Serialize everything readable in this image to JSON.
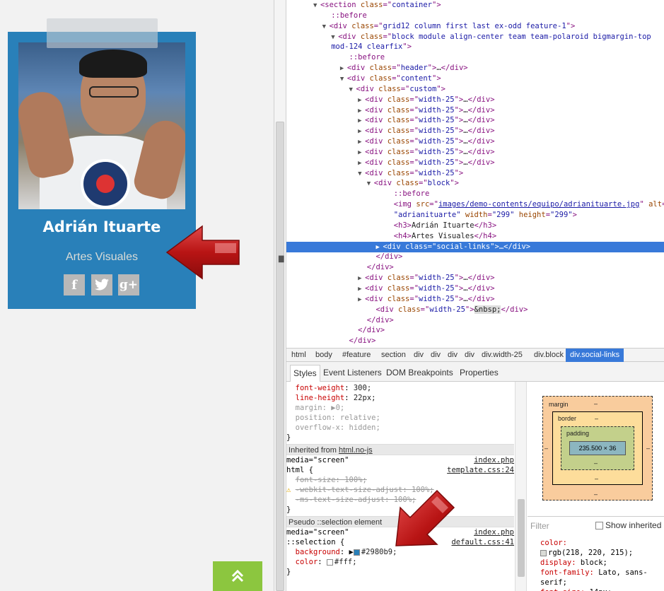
{
  "page": {
    "member_name": "Adrián Ituarte",
    "member_role": "Artes Visuales",
    "social": [
      "f",
      "t",
      "g+"
    ],
    "scroll_top_icon": "double-chevron-up-icon",
    "accent": "#2980b9",
    "scroll_top_color": "#8cc63f"
  },
  "tree": [
    {
      "t": "▼",
      "i": 3,
      "parts": [
        [
          "tag",
          "<section "
        ],
        [
          "an",
          "class"
        ],
        [
          "tag",
          "=\""
        ],
        [
          "av",
          "container"
        ],
        [
          "tag",
          "\">"
        ]
      ]
    },
    {
      "t": "",
      "i": 4,
      "parts": [
        [
          "pseudo",
          "::before"
        ]
      ]
    },
    {
      "t": "▼",
      "i": 4,
      "parts": [
        [
          "tag",
          "<div "
        ],
        [
          "an",
          "class"
        ],
        [
          "tag",
          "=\""
        ],
        [
          "av",
          "grid12 column first last ex-odd feature-1"
        ],
        [
          "tag",
          "\">"
        ]
      ]
    },
    {
      "t": "▼",
      "i": 5,
      "parts": [
        [
          "tag",
          "<div "
        ],
        [
          "an",
          "class"
        ],
        [
          "tag",
          "=\""
        ],
        [
          "av",
          "block module align-center team team-polaroid bigmargin-top"
        ]
      ]
    },
    {
      "t": "",
      "i": 4,
      "parts": [
        [
          "av",
          "mod-124 clearfix"
        ],
        [
          "tag",
          "\">"
        ]
      ]
    },
    {
      "t": "",
      "i": 6,
      "parts": [
        [
          "pseudo",
          "::before"
        ]
      ]
    },
    {
      "t": "▶",
      "i": 6,
      "parts": [
        [
          "tag",
          "<div "
        ],
        [
          "an",
          "class"
        ],
        [
          "tag",
          "=\""
        ],
        [
          "av",
          "header"
        ],
        [
          "tag",
          "\">"
        ],
        [
          "plain",
          "…"
        ],
        [
          "tag",
          "</div>"
        ]
      ]
    },
    {
      "t": "▼",
      "i": 6,
      "parts": [
        [
          "tag",
          "<div "
        ],
        [
          "an",
          "class"
        ],
        [
          "tag",
          "=\""
        ],
        [
          "av",
          "content"
        ],
        [
          "tag",
          "\">"
        ]
      ]
    },
    {
      "t": "▼",
      "i": 7,
      "parts": [
        [
          "tag",
          "<div "
        ],
        [
          "an",
          "class"
        ],
        [
          "tag",
          "=\""
        ],
        [
          "av",
          "custom"
        ],
        [
          "tag",
          "\">"
        ]
      ]
    },
    {
      "t": "▶",
      "i": 8,
      "parts": [
        [
          "tag",
          "<div "
        ],
        [
          "an",
          "class"
        ],
        [
          "tag",
          "=\""
        ],
        [
          "av",
          "width-25"
        ],
        [
          "tag",
          "\">"
        ],
        [
          "plain",
          "…"
        ],
        [
          "tag",
          "</div>"
        ]
      ]
    },
    {
      "t": "▶",
      "i": 8,
      "parts": [
        [
          "tag",
          "<div "
        ],
        [
          "an",
          "class"
        ],
        [
          "tag",
          "=\""
        ],
        [
          "av",
          "width-25"
        ],
        [
          "tag",
          "\">"
        ],
        [
          "plain",
          "…"
        ],
        [
          "tag",
          "</div>"
        ]
      ]
    },
    {
      "t": "▶",
      "i": 8,
      "parts": [
        [
          "tag",
          "<div "
        ],
        [
          "an",
          "class"
        ],
        [
          "tag",
          "=\""
        ],
        [
          "av",
          "width-25"
        ],
        [
          "tag",
          "\">"
        ],
        [
          "plain",
          "…"
        ],
        [
          "tag",
          "</div>"
        ]
      ]
    },
    {
      "t": "▶",
      "i": 8,
      "parts": [
        [
          "tag",
          "<div "
        ],
        [
          "an",
          "class"
        ],
        [
          "tag",
          "=\""
        ],
        [
          "av",
          "width-25"
        ],
        [
          "tag",
          "\">"
        ],
        [
          "plain",
          "…"
        ],
        [
          "tag",
          "</div>"
        ]
      ]
    },
    {
      "t": "▶",
      "i": 8,
      "parts": [
        [
          "tag",
          "<div "
        ],
        [
          "an",
          "class"
        ],
        [
          "tag",
          "=\""
        ],
        [
          "av",
          "width-25"
        ],
        [
          "tag",
          "\">"
        ],
        [
          "plain",
          "…"
        ],
        [
          "tag",
          "</div>"
        ]
      ]
    },
    {
      "t": "▶",
      "i": 8,
      "parts": [
        [
          "tag",
          "<div "
        ],
        [
          "an",
          "class"
        ],
        [
          "tag",
          "=\""
        ],
        [
          "av",
          "width-25"
        ],
        [
          "tag",
          "\">"
        ],
        [
          "plain",
          "…"
        ],
        [
          "tag",
          "</div>"
        ]
      ]
    },
    {
      "t": "▶",
      "i": 8,
      "parts": [
        [
          "tag",
          "<div "
        ],
        [
          "an",
          "class"
        ],
        [
          "tag",
          "=\""
        ],
        [
          "av",
          "width-25"
        ],
        [
          "tag",
          "\">"
        ],
        [
          "plain",
          "…"
        ],
        [
          "tag",
          "</div>"
        ]
      ]
    },
    {
      "t": "▼",
      "i": 8,
      "parts": [
        [
          "tag",
          "<div "
        ],
        [
          "an",
          "class"
        ],
        [
          "tag",
          "=\""
        ],
        [
          "av",
          "width-25"
        ],
        [
          "tag",
          "\">"
        ]
      ]
    },
    {
      "t": "▼",
      "i": 9,
      "parts": [
        [
          "tag",
          "<div "
        ],
        [
          "an",
          "class"
        ],
        [
          "tag",
          "=\""
        ],
        [
          "av",
          "block"
        ],
        [
          "tag",
          "\">"
        ]
      ]
    },
    {
      "t": "",
      "i": 11,
      "parts": [
        [
          "pseudo",
          "::before"
        ]
      ]
    },
    {
      "t": "",
      "i": 11,
      "parts": [
        [
          "tag",
          "<img "
        ],
        [
          "an",
          "src"
        ],
        [
          "tag",
          "=\""
        ],
        [
          "lnk",
          "images/demo-contents/equipo/adrianituarte.jpg"
        ],
        [
          "tag",
          "\" "
        ],
        [
          "an",
          "alt"
        ],
        [
          "tag",
          "="
        ]
      ]
    },
    {
      "t": "",
      "i": 11,
      "parts": [
        [
          "av",
          "\"adrianituarte\" "
        ],
        [
          "an",
          "width"
        ],
        [
          "tag",
          "="
        ],
        [
          "av",
          "\"299\" "
        ],
        [
          "an",
          "height"
        ],
        [
          "tag",
          "="
        ],
        [
          "av",
          "\"299\""
        ],
        [
          "tag",
          ">"
        ]
      ]
    },
    {
      "t": "",
      "i": 11,
      "parts": [
        [
          "tag",
          "<h3>"
        ],
        [
          "plain",
          "Adrián Ituarte"
        ],
        [
          "tag",
          "</h3>"
        ]
      ]
    },
    {
      "t": "",
      "i": 11,
      "parts": [
        [
          "tag",
          "<h4>"
        ],
        [
          "plain",
          "Artes Visuales"
        ],
        [
          "tag",
          "</h4>"
        ]
      ]
    },
    {
      "t": "▶",
      "i": 10,
      "sel": true,
      "parts": [
        [
          "tag",
          "<div "
        ],
        [
          "an",
          "class"
        ],
        [
          "tag",
          "=\""
        ],
        [
          "av",
          "social-links"
        ],
        [
          "tag",
          "\">"
        ],
        [
          "plain",
          "…"
        ],
        [
          "tag",
          "</div>"
        ]
      ]
    },
    {
      "t": "",
      "i": 9,
      "parts": [
        [
          "tag",
          "</div>"
        ]
      ]
    },
    {
      "t": "",
      "i": 8,
      "parts": [
        [
          "tag",
          "</div>"
        ]
      ]
    },
    {
      "t": "▶",
      "i": 8,
      "parts": [
        [
          "tag",
          "<div "
        ],
        [
          "an",
          "class"
        ],
        [
          "tag",
          "=\""
        ],
        [
          "av",
          "width-25"
        ],
        [
          "tag",
          "\">"
        ],
        [
          "plain",
          "…"
        ],
        [
          "tag",
          "</div>"
        ]
      ]
    },
    {
      "t": "▶",
      "i": 8,
      "parts": [
        [
          "tag",
          "<div "
        ],
        [
          "an",
          "class"
        ],
        [
          "tag",
          "=\""
        ],
        [
          "av",
          "width-25"
        ],
        [
          "tag",
          "\">"
        ],
        [
          "plain",
          "…"
        ],
        [
          "tag",
          "</div>"
        ]
      ]
    },
    {
      "t": "▶",
      "i": 8,
      "parts": [
        [
          "tag",
          "<div "
        ],
        [
          "an",
          "class"
        ],
        [
          "tag",
          "=\""
        ],
        [
          "av",
          "width-25"
        ],
        [
          "tag",
          "\">"
        ],
        [
          "plain",
          "…"
        ],
        [
          "tag",
          "</div>"
        ]
      ]
    },
    {
      "t": "",
      "i": 9,
      "parts": [
        [
          "tag",
          "<div "
        ],
        [
          "an",
          "class"
        ],
        [
          "tag",
          "=\""
        ],
        [
          "av",
          "width-25"
        ],
        [
          "tag",
          "\">"
        ],
        [
          "nbsp",
          "&nbsp;"
        ],
        [
          "tag",
          "</div>"
        ]
      ]
    },
    {
      "t": "",
      "i": 8,
      "parts": [
        [
          "tag",
          "</div>"
        ]
      ]
    },
    {
      "t": "",
      "i": 7,
      "parts": [
        [
          "tag",
          "</div>"
        ]
      ]
    },
    {
      "t": "",
      "i": 6,
      "parts": [
        [
          "tag",
          "</div>"
        ]
      ]
    },
    {
      "t": "",
      "i": 6,
      "parts": [
        [
          "pseudo",
          "::after"
        ]
      ]
    }
  ],
  "breadcrumbs": [
    "html",
    "body",
    "#feature",
    "section",
    "div",
    "div",
    "div",
    "div",
    "div.width-25",
    "div.block",
    "div.social-links"
  ],
  "tabs": [
    "Styles",
    "Event Listeners",
    "DOM Breakpoints",
    "Properties"
  ],
  "styles": {
    "rule1": [
      {
        "prop": "font-weight",
        "val": "300;"
      },
      {
        "prop": "line-height",
        "val": "22px;"
      },
      {
        "prop": "margin",
        "val": "▶0;",
        "dim": true
      },
      {
        "prop": "position",
        "val": "relative;",
        "dim": true
      },
      {
        "prop": "overflow-x",
        "val": "hidden;",
        "dim": true
      }
    ],
    "inherited_label": "Inherited from ",
    "inherited_link": "html.no-js",
    "media": "media=\"screen\"",
    "html_selector": "html {",
    "index_file": "index.php",
    "template_file": "template.css:24",
    "html_rule": [
      {
        "text": "font-size: 100%;",
        "strike": true
      },
      {
        "text": "-webkit-text-size-adjust: 100%;",
        "strike": true,
        "warn": true
      },
      {
        "text": "-ms-text-size-adjust: 100%;",
        "strike": true
      }
    ],
    "pseudo_label": "Pseudo ::selection element",
    "selection_selector": "::selection {",
    "default_file": "default.css:41",
    "selection_rule": [
      {
        "prop": "background",
        "val": "#2980b9;",
        "swatch": "#2980b9",
        "arrow": true
      },
      {
        "prop": "color",
        "val": "#fff;",
        "swatch": "#ffffff"
      }
    ]
  },
  "metrics": {
    "margin_label": "margin",
    "border_label": "border",
    "padding_label": "padding",
    "dash": "–",
    "content_size": "235.500 × 36"
  },
  "computed": {
    "filter_placeholder": "Filter",
    "show_inherited": "Show inherited",
    "lines": [
      {
        "prop": "color",
        "val": ""
      },
      {
        "swatch": "#dadcd7",
        "val": "rgb(218, 220, 215);"
      },
      {
        "prop": "display",
        "val": "block;"
      },
      {
        "prop": "font-family",
        "val": "Lato, sans-"
      },
      {
        "val": "serif;"
      },
      {
        "prop": "font-size",
        "val": "14px;"
      }
    ]
  }
}
